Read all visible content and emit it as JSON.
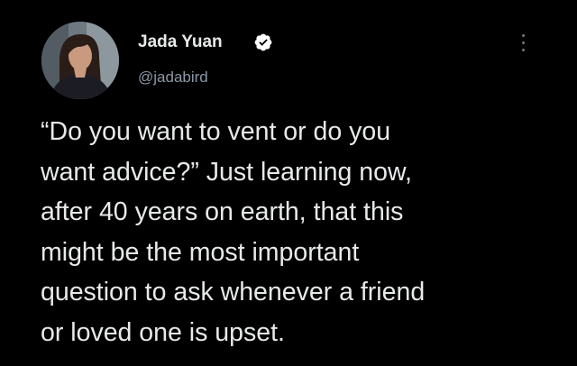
{
  "author": {
    "name": "Jada Yuan",
    "handle": "@jadabird",
    "verified": true,
    "avatar_icon": "profile-photo",
    "verified_icon": "verified-badge-icon"
  },
  "more_icon": "more-vertical-icon",
  "tweet": {
    "lines": [
      "“Do you want to vent or do you",
      "want advice?” Just learning now,",
      "after 40 years on earth, that this",
      "might be the most important",
      "question to ask whenever a friend",
      "or loved one is upset."
    ]
  },
  "colors": {
    "background": "#000000",
    "text": "#e7e9ea",
    "secondary": "#8b98a5",
    "verified": "#ffffff"
  }
}
